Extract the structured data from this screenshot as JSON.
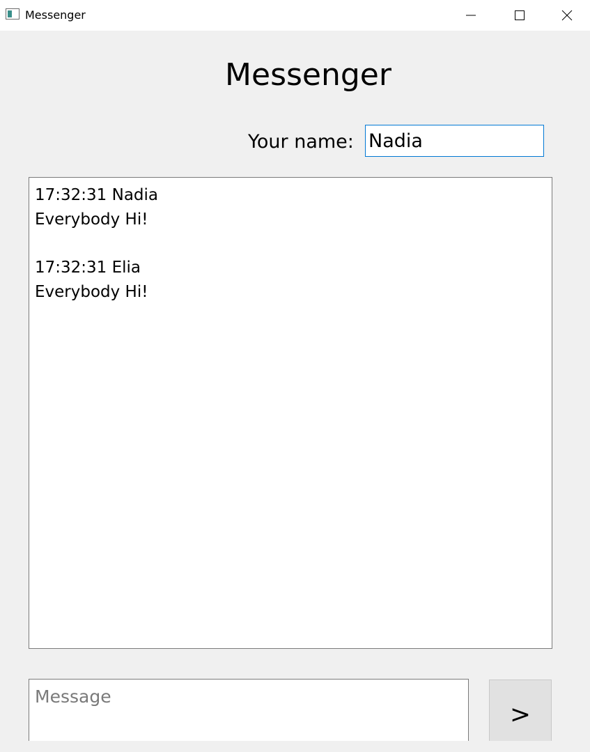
{
  "window": {
    "title": "Messenger",
    "icons": {
      "app": "app-window-icon",
      "minimize": "minimize-icon",
      "maximize": "maximize-icon",
      "close": "close-icon"
    }
  },
  "header": {
    "title": "Messenger"
  },
  "name_field": {
    "label": "Your name:",
    "value": "Nadia"
  },
  "chat": {
    "messages": [
      {
        "meta": "17:32:31 Nadia",
        "text": "Everybody Hi!"
      },
      {
        "meta": "17:32:31 Elia",
        "text": "Everybody Hi!"
      }
    ]
  },
  "composer": {
    "placeholder": "Message",
    "value": "",
    "send_label": ">"
  },
  "colors": {
    "window_bg": "#f0f0f0",
    "focus_border": "#0078d4",
    "button_bg": "#e1e1e1"
  }
}
